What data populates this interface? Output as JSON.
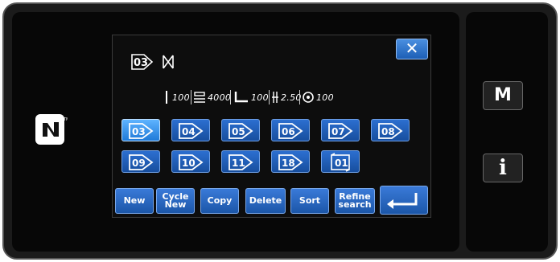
{
  "current_pattern": {
    "code": "03"
  },
  "params": {
    "stitch_count": "100",
    "speed": "4000",
    "presser": "100",
    "pitch": "2.50",
    "tension": "100"
  },
  "patterns": [
    {
      "code": "03",
      "selected": true
    },
    {
      "code": "04",
      "selected": false
    },
    {
      "code": "05",
      "selected": false
    },
    {
      "code": "06",
      "selected": false
    },
    {
      "code": "07",
      "selected": false
    },
    {
      "code": "08",
      "selected": false
    },
    {
      "code": "09",
      "selected": false
    },
    {
      "code": "10",
      "selected": false
    },
    {
      "code": "11",
      "selected": false
    },
    {
      "code": "18",
      "selected": false
    }
  ],
  "cycle_pattern": {
    "code": "01"
  },
  "buttons": {
    "new": "New",
    "cycle_new_1": "Cycle",
    "cycle_new_2": "New",
    "copy": "Copy",
    "delete": "Delete",
    "sort": "Sort",
    "refine_1": "Refine",
    "refine_2": "search",
    "close": "✕"
  },
  "side": {
    "mode": "M",
    "info": "i"
  },
  "colors": {
    "button_blue": "#1f5fb8",
    "selected_blue": "#3a98f0",
    "screen_bg": "#0d0d0d"
  }
}
